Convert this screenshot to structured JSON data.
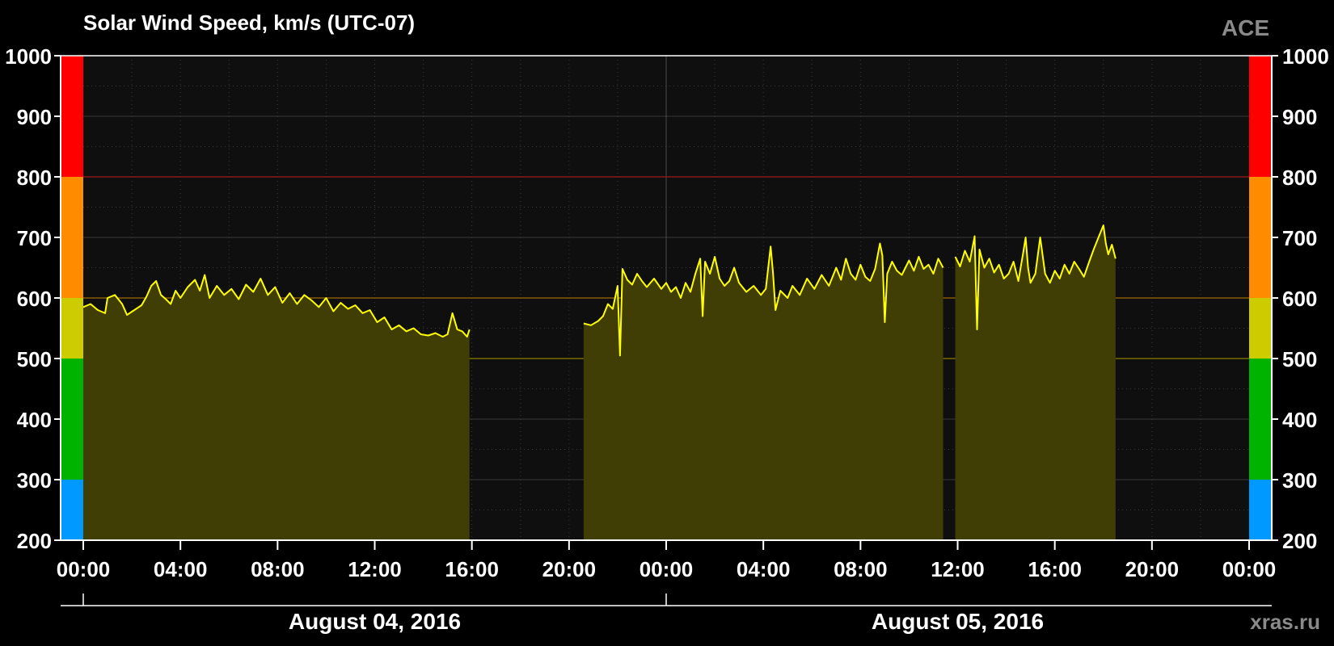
{
  "chart_data": {
    "type": "area",
    "title": "Solar Wind Speed, km/s (UTC-07)",
    "source_label": "ACE",
    "watermark": "xras.ru",
    "ylim": [
      200,
      1000
    ],
    "y_ticks": [
      "200",
      "300",
      "400",
      "500",
      "600",
      "700",
      "800",
      "900",
      "1000"
    ],
    "x_ticks": [
      "00:00",
      "04:00",
      "08:00",
      "12:00",
      "16:00",
      "20:00",
      "00:00",
      "04:00",
      "08:00",
      "12:00",
      "16:00",
      "20:00",
      "00:00"
    ],
    "x_range_hours": [
      0,
      48
    ],
    "dates": [
      "August 04, 2016",
      "August 05, 2016"
    ],
    "grid": true,
    "threshold_lines": [
      500,
      600,
      800
    ],
    "scale_bands": [
      {
        "from": 200,
        "to": 300,
        "color": "#0099ff"
      },
      {
        "from": 300,
        "to": 500,
        "color": "#00b300"
      },
      {
        "from": 500,
        "to": 600,
        "color": "#cccc00"
      },
      {
        "from": 600,
        "to": 800,
        "color": "#ff8c00"
      },
      {
        "from": 800,
        "to": 1000,
        "color": "#ff0000"
      }
    ],
    "colors": {
      "line": "#ffff00",
      "fill": "#403d05",
      "plot_bg": "#0f0f0f"
    },
    "series": [
      {
        "values": [
          [
            0.0,
            585
          ],
          [
            0.3,
            590
          ],
          [
            0.6,
            580
          ],
          [
            0.9,
            575
          ],
          [
            1.0,
            600
          ],
          [
            1.3,
            605
          ],
          [
            1.6,
            590
          ],
          [
            1.8,
            572
          ],
          [
            2.1,
            580
          ],
          [
            2.4,
            588
          ],
          [
            2.6,
            602
          ],
          [
            2.8,
            620
          ],
          [
            3.0,
            628
          ],
          [
            3.2,
            605
          ],
          [
            3.4,
            598
          ],
          [
            3.6,
            590
          ],
          [
            3.8,
            612
          ],
          [
            4.0,
            600
          ],
          [
            4.3,
            618
          ],
          [
            4.6,
            630
          ],
          [
            4.8,
            612
          ],
          [
            5.0,
            638
          ],
          [
            5.2,
            600
          ],
          [
            5.5,
            620
          ],
          [
            5.8,
            605
          ],
          [
            6.1,
            615
          ],
          [
            6.4,
            598
          ],
          [
            6.7,
            622
          ],
          [
            7.0,
            610
          ],
          [
            7.3,
            632
          ],
          [
            7.6,
            605
          ],
          [
            7.9,
            618
          ],
          [
            8.2,
            592
          ],
          [
            8.5,
            608
          ],
          [
            8.8,
            590
          ],
          [
            9.1,
            605
          ],
          [
            9.4,
            596
          ],
          [
            9.7,
            585
          ],
          [
            10.0,
            600
          ],
          [
            10.3,
            578
          ],
          [
            10.6,
            592
          ],
          [
            10.9,
            582
          ],
          [
            11.2,
            588
          ],
          [
            11.5,
            575
          ],
          [
            11.8,
            580
          ],
          [
            12.1,
            560
          ],
          [
            12.4,
            568
          ],
          [
            12.7,
            548
          ],
          [
            13.0,
            555
          ],
          [
            13.3,
            545
          ],
          [
            13.6,
            550
          ],
          [
            13.9,
            540
          ],
          [
            14.2,
            538
          ],
          [
            14.5,
            542
          ],
          [
            14.8,
            536
          ],
          [
            15.0,
            540
          ],
          [
            15.2,
            575
          ],
          [
            15.4,
            548
          ],
          [
            15.6,
            545
          ],
          [
            15.8,
            536
          ],
          [
            15.9,
            548
          ],
          {
            "gap": true
          },
          [
            20.6,
            558
          ],
          [
            20.9,
            555
          ],
          [
            21.2,
            562
          ],
          [
            21.4,
            570
          ],
          [
            21.6,
            590
          ],
          [
            21.8,
            582
          ],
          [
            22.0,
            620
          ],
          [
            22.1,
            505
          ],
          [
            22.2,
            648
          ],
          [
            22.4,
            630
          ],
          [
            22.6,
            622
          ],
          [
            22.8,
            640
          ],
          [
            23.0,
            628
          ],
          [
            23.2,
            618
          ],
          [
            23.5,
            632
          ],
          [
            23.8,
            615
          ],
          [
            24.0,
            625
          ],
          [
            24.2,
            610
          ],
          [
            24.4,
            618
          ],
          [
            24.6,
            600
          ],
          [
            24.8,
            625
          ],
          [
            25.0,
            610
          ],
          [
            25.2,
            640
          ],
          [
            25.4,
            665
          ],
          [
            25.5,
            570
          ],
          [
            25.6,
            660
          ],
          [
            25.8,
            640
          ],
          [
            26.0,
            668
          ],
          [
            26.2,
            632
          ],
          [
            26.4,
            620
          ],
          [
            26.6,
            628
          ],
          [
            26.8,
            650
          ],
          [
            27.0,
            625
          ],
          [
            27.3,
            610
          ],
          [
            27.6,
            620
          ],
          [
            27.9,
            605
          ],
          [
            28.1,
            615
          ],
          [
            28.3,
            685
          ],
          [
            28.4,
            640
          ],
          [
            28.5,
            580
          ],
          [
            28.7,
            612
          ],
          [
            29.0,
            600
          ],
          [
            29.2,
            620
          ],
          [
            29.5,
            605
          ],
          [
            29.8,
            632
          ],
          [
            30.1,
            615
          ],
          [
            30.4,
            638
          ],
          [
            30.7,
            620
          ],
          [
            31.0,
            650
          ],
          [
            31.2,
            630
          ],
          [
            31.4,
            665
          ],
          [
            31.6,
            640
          ],
          [
            31.8,
            630
          ],
          [
            32.0,
            655
          ],
          [
            32.2,
            635
          ],
          [
            32.4,
            628
          ],
          [
            32.6,
            648
          ],
          [
            32.8,
            690
          ],
          [
            32.9,
            670
          ],
          [
            33.0,
            560
          ],
          [
            33.1,
            640
          ],
          [
            33.3,
            660
          ],
          [
            33.5,
            645
          ],
          [
            33.7,
            638
          ],
          [
            34.0,
            662
          ],
          [
            34.2,
            645
          ],
          [
            34.4,
            668
          ],
          [
            34.6,
            648
          ],
          [
            34.8,
            655
          ],
          [
            35.0,
            640
          ],
          [
            35.2,
            665
          ],
          [
            35.4,
            650
          ],
          {
            "gap": true
          },
          [
            35.9,
            668
          ],
          [
            36.1,
            652
          ],
          [
            36.3,
            678
          ],
          [
            36.5,
            660
          ],
          [
            36.7,
            702
          ],
          [
            36.8,
            548
          ],
          [
            36.9,
            680
          ],
          [
            37.1,
            650
          ],
          [
            37.3,
            665
          ],
          [
            37.5,
            642
          ],
          [
            37.7,
            655
          ],
          [
            37.9,
            632
          ],
          [
            38.1,
            640
          ],
          [
            38.3,
            660
          ],
          [
            38.5,
            628
          ],
          [
            38.7,
            675
          ],
          [
            38.8,
            700
          ],
          [
            38.9,
            650
          ],
          [
            39.0,
            625
          ],
          [
            39.2,
            640
          ],
          [
            39.4,
            700
          ],
          [
            39.6,
            640
          ],
          [
            39.8,
            625
          ],
          [
            40.0,
            645
          ],
          [
            40.2,
            632
          ],
          [
            40.4,
            655
          ],
          [
            40.6,
            640
          ],
          [
            40.8,
            660
          ],
          [
            41.0,
            648
          ],
          [
            41.2,
            635
          ],
          [
            41.4,
            658
          ],
          [
            41.6,
            680
          ],
          [
            41.8,
            700
          ],
          [
            42.0,
            720
          ],
          [
            42.1,
            690
          ],
          [
            42.2,
            672
          ],
          [
            42.35,
            688
          ],
          [
            42.5,
            665
          ]
        ]
      }
    ]
  }
}
